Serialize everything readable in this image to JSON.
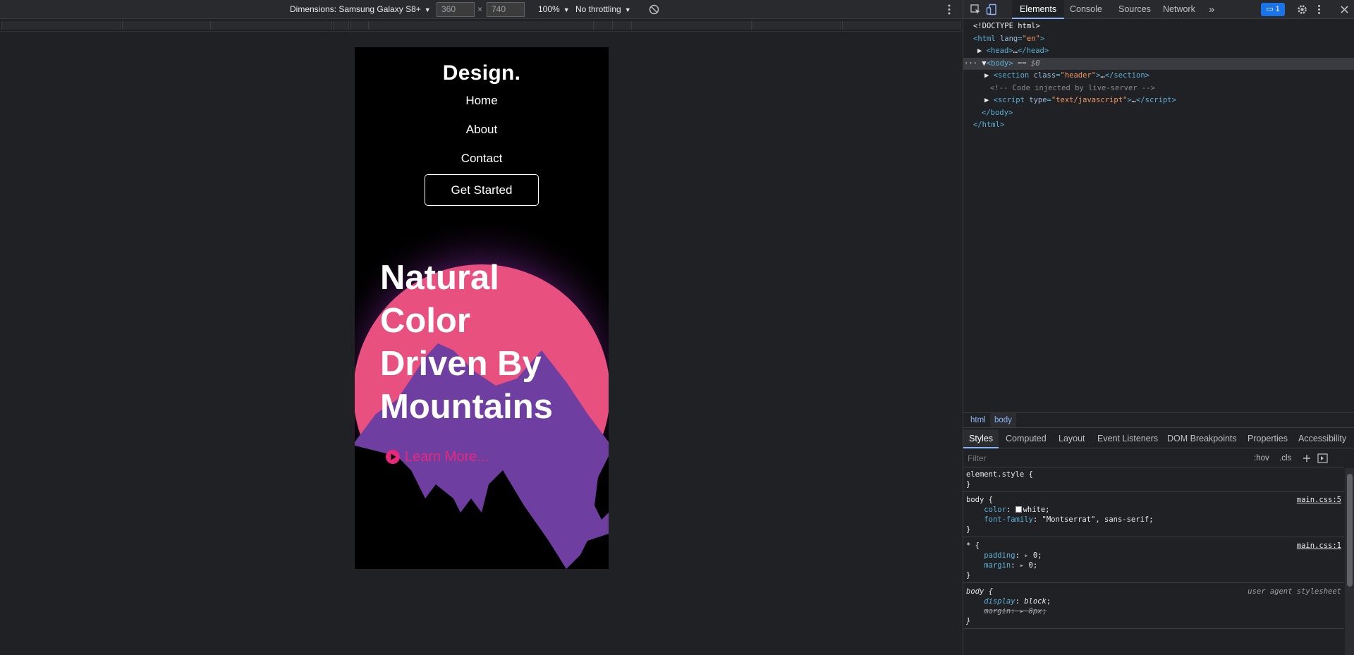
{
  "device_toolbar": {
    "dimensions_label": "Dimensions: Samsung Galaxy S8+",
    "width_value": "360",
    "height_value": "740",
    "times": "×",
    "zoom": "100%",
    "throttling": "No throttling"
  },
  "page": {
    "logo": "Design.",
    "nav": [
      "Home",
      "About",
      "Contact"
    ],
    "cta": "Get Started",
    "heading_lines": [
      "Natural",
      "Color",
      "Driven By",
      "Mountains"
    ],
    "learn_more": "Learn More...",
    "colors": {
      "background": "#000000",
      "sun": "#e8507f",
      "mountain": "#6e3ea1",
      "accent": "#e8287b"
    }
  },
  "devtools": {
    "tabs": [
      "Elements",
      "Console",
      "Sources",
      "Network"
    ],
    "more_tabs": "»",
    "issues_count": "1",
    "tree": {
      "doctype": "<!DOCTYPE html>",
      "html_open_tag": "html",
      "lang_attr": "lang",
      "lang_val": "\"en\"",
      "head": "head",
      "body": "body",
      "body_eq": "== $0",
      "section_tag": "section",
      "class_attr": "class",
      "section_class": "\"header\"",
      "section_ellipsis": "…",
      "comment": "<!-- Code injected by live-server -->",
      "script_tag": "script",
      "type_attr": "type",
      "script_type": "\"text/javascript\"",
      "body_close": "body",
      "html_close": "html"
    },
    "breadcrumbs": [
      "html",
      "body"
    ],
    "styles_tabs": [
      "Styles",
      "Computed",
      "Layout",
      "Event Listeners",
      "DOM Breakpoints",
      "Properties",
      "Accessibility"
    ],
    "filter_placeholder": "Filter",
    "hov": ":hov",
    "cls": ".cls",
    "rules": {
      "element_style": "element.style {",
      "close": "}",
      "body_sel": "body {",
      "body_src": "main.css:5",
      "color_prop": "color",
      "color_val": "white",
      "font_prop": "font-family",
      "font_val": "\"Montserrat\", sans-serif",
      "star_sel": "* {",
      "star_src": "main.css:1",
      "padding_prop": "padding",
      "padding_val": "0",
      "margin_prop": "margin",
      "margin_val": "0",
      "ua_sel": "body {",
      "ua_src": "user agent stylesheet",
      "display_prop": "display",
      "display_val": "block",
      "ua_margin_prop": "margin",
      "ua_margin_val": "8px"
    }
  }
}
